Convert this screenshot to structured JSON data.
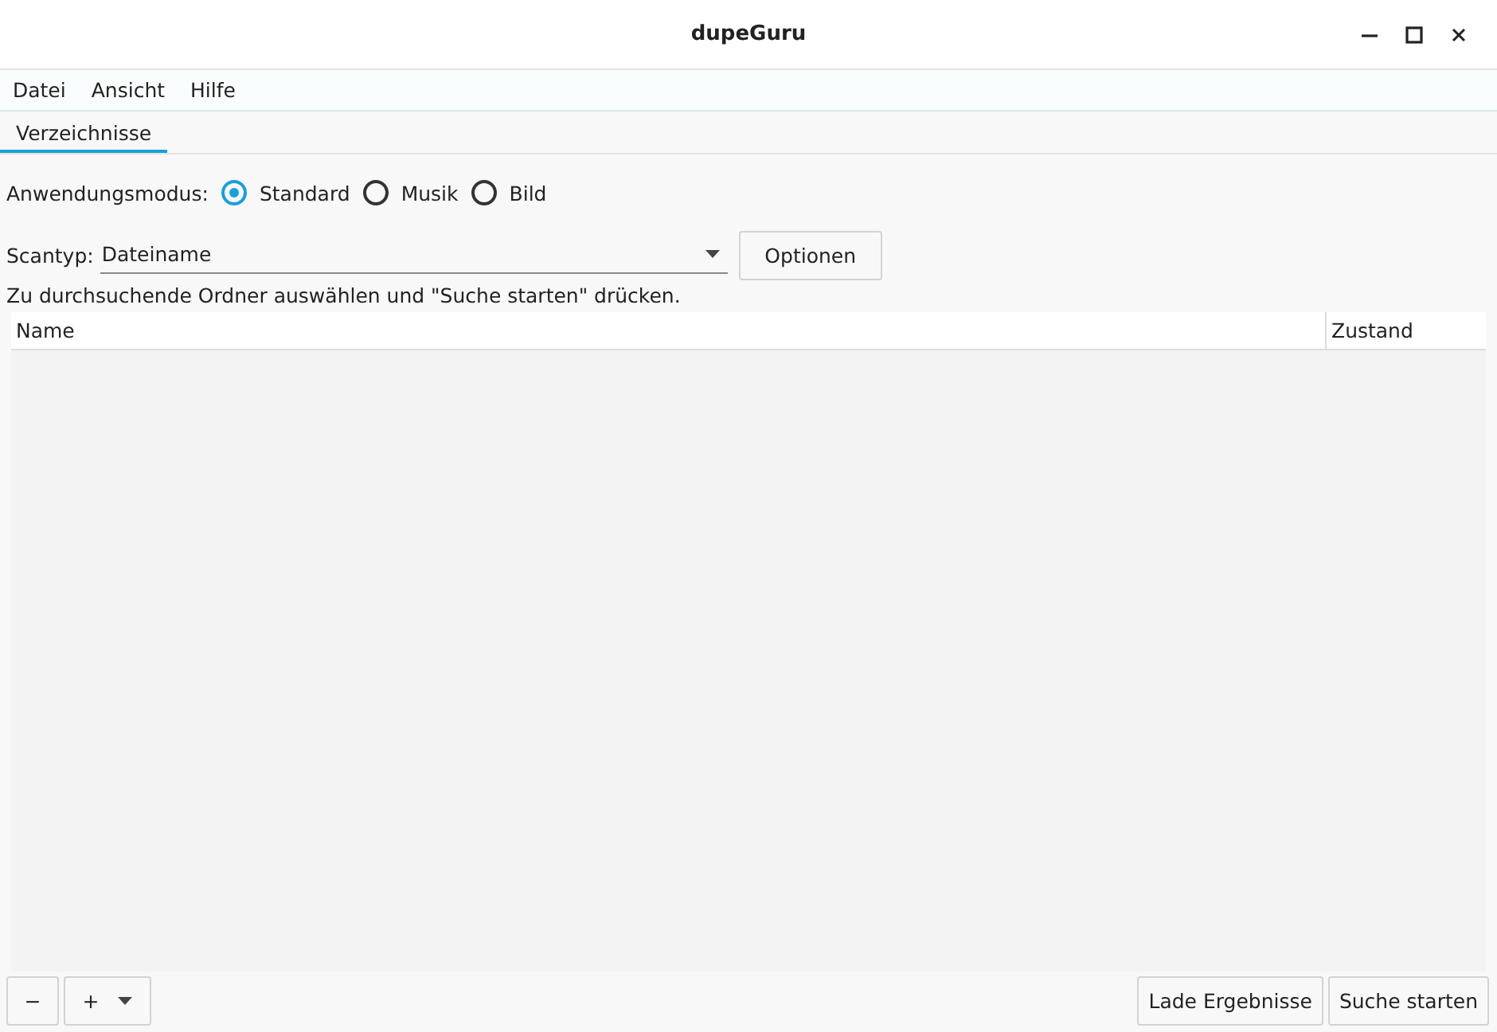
{
  "window": {
    "title": "dupeGuru"
  },
  "menu": [
    "Datei",
    "Ansicht",
    "Hilfe"
  ],
  "tabs": [
    {
      "label": "Verzeichnisse",
      "selected": true
    }
  ],
  "app_mode": {
    "label": "Anwendungsmodus:",
    "options": [
      {
        "label": "Standard",
        "selected": true
      },
      {
        "label": "Musik",
        "selected": false
      },
      {
        "label": "Bild",
        "selected": false
      }
    ]
  },
  "scan_type": {
    "label": "Scantyp:",
    "value": "Dateiname"
  },
  "options_button": "Optionen",
  "hint": "Zu durchsuchende Ordner auswählen und \"Suche starten\" drücken.",
  "table": {
    "columns": [
      "Name",
      "Zustand"
    ]
  },
  "remove_button": "−",
  "add_button": "+",
  "buttons": [
    "Lade Ergebnisse",
    "Suche starten"
  ]
}
